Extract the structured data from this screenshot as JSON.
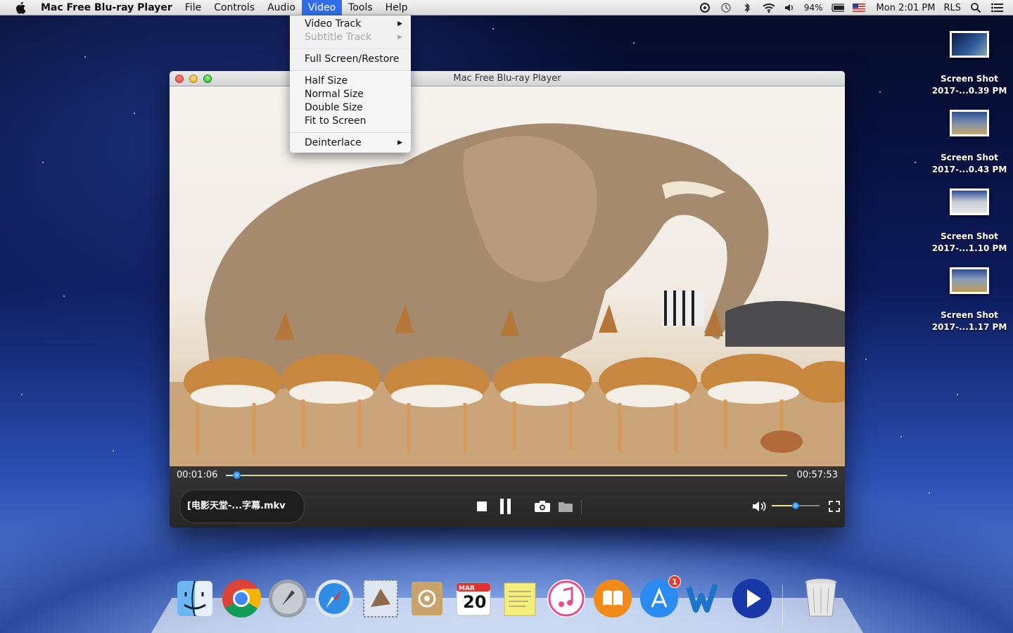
{
  "menubar": {
    "app_name": "Mac Free Blu-ray Player",
    "items": [
      "File",
      "Controls",
      "Audio",
      "Video",
      "Tools",
      "Help"
    ],
    "active": "Video",
    "battery": "94%",
    "clock": "Mon 2:01 PM",
    "user": "RLS"
  },
  "video_menu": {
    "video_track": "Video Track",
    "subtitle_track": "Subtitle Track",
    "full_screen": "Full Screen/Restore",
    "half_size": "Half Size",
    "normal_size": "Normal Size",
    "double_size": "Double Size",
    "fit_to_screen": "Fit to Screen",
    "deinterlace": "Deinterlace"
  },
  "player": {
    "title": "Mac Free Blu-ray Player",
    "current_time": "00:01:06",
    "total_time": "00:57:53",
    "progress": 0.019,
    "volume": 0.5,
    "filename": "[电影天堂-...字幕.mkv"
  },
  "desktop": {
    "files": [
      {
        "title": "Screen Shot",
        "subtitle": "2017-...0.39 PM"
      },
      {
        "title": "Screen Shot",
        "subtitle": "2017-...0.43 PM"
      },
      {
        "title": "Screen Shot",
        "subtitle": "2017-...1.10 PM"
      },
      {
        "title": "Screen Shot",
        "subtitle": "2017-...1.17 PM"
      }
    ]
  },
  "dock": {
    "calendar_month": "MAR",
    "calendar_day": "20",
    "app_store_badge": "1"
  },
  "colors": {
    "menu_highlight": "#2f6ee8",
    "seek_knob": "#1a6fd0",
    "control_bg": "#2d2d2d"
  }
}
